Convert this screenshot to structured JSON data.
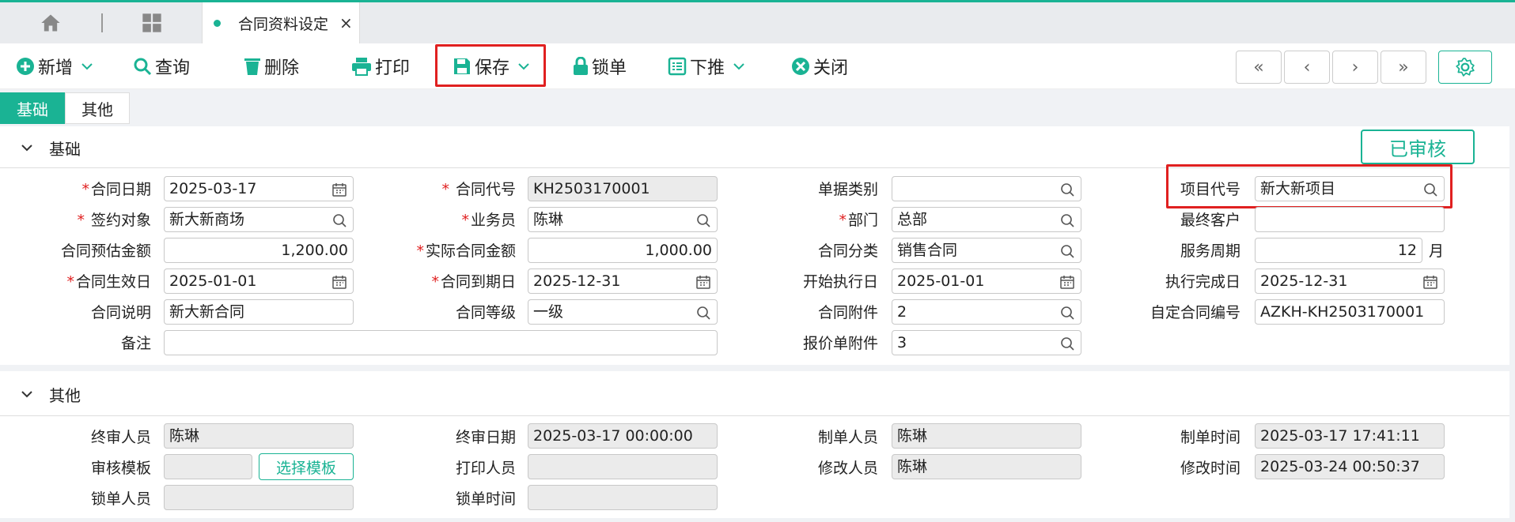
{
  "tabs": {
    "active_tab": "合同资料设定",
    "close": "×"
  },
  "toolbar": {
    "add": "新增",
    "query": "查询",
    "delete": "删除",
    "print": "打印",
    "save": "保存",
    "lock": "锁单",
    "push": "下推",
    "close": "关闭",
    "first": "«",
    "prev": "‹",
    "next": "›",
    "last": "»"
  },
  "subtabs": {
    "basic": "基础",
    "other": "其他"
  },
  "status_stamp": "已审核",
  "sections": {
    "basic": "基础",
    "other": "其他"
  },
  "basic": {
    "contract_date": {
      "label": "合同日期",
      "value": "2025-03-17"
    },
    "contract_code": {
      "label": "合同代号",
      "value": "KH2503170001"
    },
    "doc_type": {
      "label": "单据类别",
      "value": ""
    },
    "project_code": {
      "label": "项目代号",
      "value": "新大新项目"
    },
    "counterparty": {
      "label": "签约对象",
      "value": "新大新商场"
    },
    "salesman": {
      "label": "业务员",
      "value": "陈琳"
    },
    "department": {
      "label": "部门",
      "value": "总部"
    },
    "end_customer": {
      "label": "最终客户",
      "value": ""
    },
    "estimated_amount": {
      "label": "合同预估金额",
      "value": "1,200.00"
    },
    "actual_amount": {
      "label": "实际合同金额",
      "value": "1,000.00"
    },
    "category": {
      "label": "合同分类",
      "value": "销售合同"
    },
    "service_period": {
      "label": "服务周期",
      "value": "12",
      "unit": "月"
    },
    "effective_date": {
      "label": "合同生效日",
      "value": "2025-01-01"
    },
    "expiry_date": {
      "label": "合同到期日",
      "value": "2025-12-31"
    },
    "exec_start": {
      "label": "开始执行日",
      "value": "2025-01-01"
    },
    "exec_end": {
      "label": "执行完成日",
      "value": "2025-12-31"
    },
    "description": {
      "label": "合同说明",
      "value": "新大新合同"
    },
    "grade": {
      "label": "合同等级",
      "value": "一级"
    },
    "attachments": {
      "label": "合同附件",
      "value": "2"
    },
    "custom_no": {
      "label": "自定合同编号",
      "value": "AZKH-KH2503170001"
    },
    "remark": {
      "label": "备注",
      "value": ""
    },
    "quote_attachments": {
      "label": "报价单附件",
      "value": "3"
    }
  },
  "other": {
    "final_reviewer": {
      "label": "终审人员",
      "value": "陈琳"
    },
    "final_review_date": {
      "label": "终审日期",
      "value": "2025-03-17 00:00:00"
    },
    "creator": {
      "label": "制单人员",
      "value": "陈琳"
    },
    "create_time": {
      "label": "制单时间",
      "value": "2025-03-17 17:41:11"
    },
    "review_template": {
      "label": "审核模板",
      "value": "",
      "button": "选择模板"
    },
    "printer": {
      "label": "打印人员",
      "value": ""
    },
    "modifier": {
      "label": "修改人员",
      "value": "陈琳"
    },
    "modify_time": {
      "label": "修改时间",
      "value": "2025-03-24 00:50:37"
    },
    "locker": {
      "label": "锁单人员",
      "value": ""
    },
    "lock_time": {
      "label": "锁单时间",
      "value": ""
    }
  },
  "colors": {
    "accent": "#1ab394",
    "highlight": "#e02020",
    "required": "#e02020"
  }
}
